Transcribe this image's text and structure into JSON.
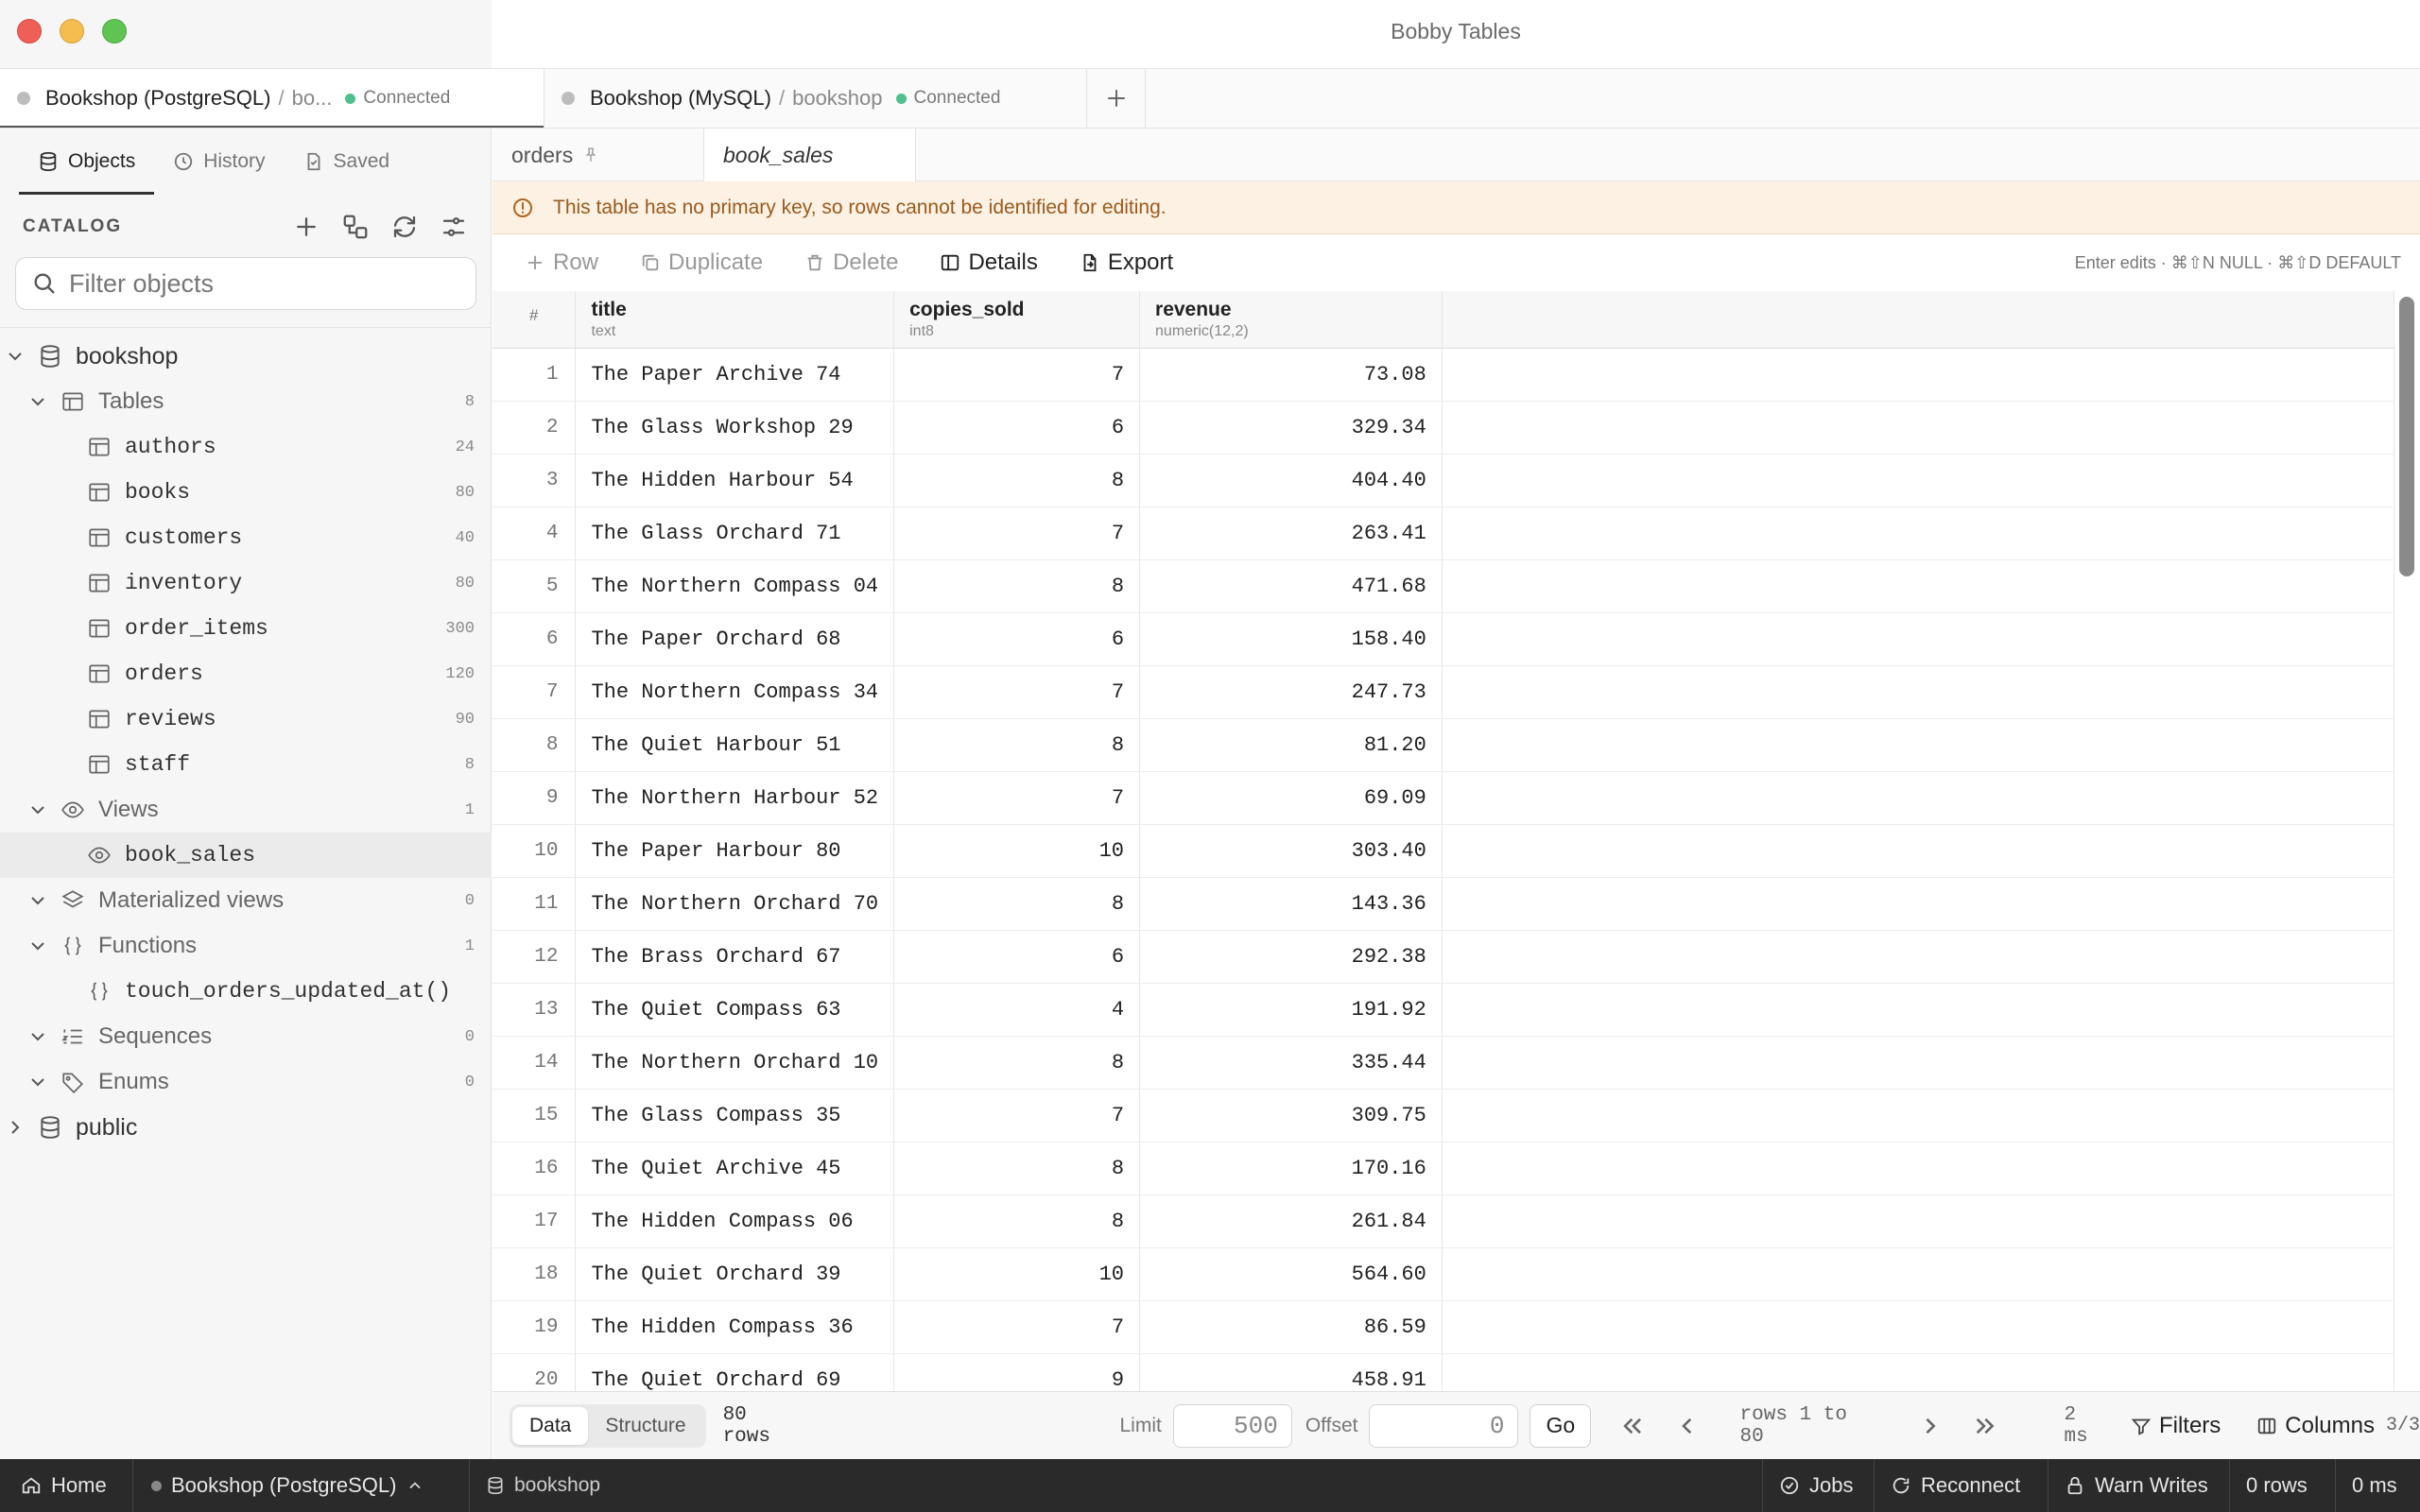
{
  "window": {
    "title": "Bobby Tables"
  },
  "connections": [
    {
      "name": "Bookshop (PostgreSQL)",
      "db": "bo...",
      "status": "Connected"
    },
    {
      "name": "Bookshop (MySQL)",
      "db": "bookshop",
      "status": "Connected"
    }
  ],
  "sidebar": {
    "tabs": [
      "Objects",
      "History",
      "Saved"
    ],
    "catalog_label": "CATALOG",
    "filter_placeholder": "Filter objects",
    "database": "bookshop",
    "tables_label": "Tables",
    "tables_count": "8",
    "tables": [
      {
        "name": "authors",
        "count": "24"
      },
      {
        "name": "books",
        "count": "80"
      },
      {
        "name": "customers",
        "count": "40"
      },
      {
        "name": "inventory",
        "count": "80"
      },
      {
        "name": "order_items",
        "count": "300"
      },
      {
        "name": "orders",
        "count": "120"
      },
      {
        "name": "reviews",
        "count": "90"
      },
      {
        "name": "staff",
        "count": "8"
      }
    ],
    "views_label": "Views",
    "views_count": "1",
    "view_item": "book_sales",
    "matviews_label": "Materialized views",
    "matviews_count": "0",
    "functions_label": "Functions",
    "functions_count": "1",
    "function_item": "touch_orders_updated_at()",
    "sequences_label": "Sequences",
    "sequences_count": "0",
    "enums_label": "Enums",
    "enums_count": "0",
    "schema2": "public"
  },
  "main": {
    "tabs": [
      "orders",
      "book_sales"
    ],
    "warning": "This table has no primary key, so rows cannot be identified for editing.",
    "toolbar": {
      "row": "Row",
      "duplicate": "Duplicate",
      "delete": "Delete",
      "details": "Details",
      "export": "Export",
      "hint": "Enter edits · ⌘⇧N NULL · ⌘⇧D DEFAULT"
    },
    "columns": [
      {
        "name": "#",
        "type": ""
      },
      {
        "name": "title",
        "type": "text"
      },
      {
        "name": "copies_sold",
        "type": "int8"
      },
      {
        "name": "revenue",
        "type": "numeric(12,2)"
      }
    ],
    "rows": [
      [
        "1",
        "The Paper Archive 74",
        "7",
        "73.08"
      ],
      [
        "2",
        "The Glass Workshop 29",
        "6",
        "329.34"
      ],
      [
        "3",
        "The Hidden Harbour 54",
        "8",
        "404.40"
      ],
      [
        "4",
        "The Glass Orchard 71",
        "7",
        "263.41"
      ],
      [
        "5",
        "The Northern Compass 04",
        "8",
        "471.68"
      ],
      [
        "6",
        "The Paper Orchard 68",
        "6",
        "158.40"
      ],
      [
        "7",
        "The Northern Compass 34",
        "7",
        "247.73"
      ],
      [
        "8",
        "The Quiet Harbour 51",
        "8",
        "81.20"
      ],
      [
        "9",
        "The Northern Harbour 52",
        "7",
        "69.09"
      ],
      [
        "10",
        "The Paper Harbour 80",
        "10",
        "303.40"
      ],
      [
        "11",
        "The Northern Orchard 70",
        "8",
        "143.36"
      ],
      [
        "12",
        "The Brass Orchard 67",
        "6",
        "292.38"
      ],
      [
        "13",
        "The Quiet Compass 63",
        "4",
        "191.92"
      ],
      [
        "14",
        "The Northern Orchard 10",
        "8",
        "335.44"
      ],
      [
        "15",
        "The Glass Compass 35",
        "7",
        "309.75"
      ],
      [
        "16",
        "The Quiet Archive 45",
        "8",
        "170.16"
      ],
      [
        "17",
        "The Hidden Compass 06",
        "8",
        "261.84"
      ],
      [
        "18",
        "The Quiet Orchard 39",
        "10",
        "564.60"
      ],
      [
        "19",
        "The Hidden Compass 36",
        "7",
        "86.59"
      ],
      [
        "20",
        "The Quiet Orchard 69",
        "9",
        "458.91"
      ]
    ],
    "bottom": {
      "seg_data": "Data",
      "seg_structure": "Structure",
      "rowcount": "80 rows",
      "limit_label": "Limit",
      "limit_value": "500",
      "offset_label": "Offset",
      "offset_value": "0",
      "go": "Go",
      "range": "rows 1 to 80",
      "time": "2 ms",
      "filters": "Filters",
      "columns_label": "Columns",
      "columns_count": "3/3"
    }
  },
  "statusbar": {
    "home": "Home",
    "connection": "Bookshop (PostgreSQL)",
    "database": "bookshop",
    "jobs": "Jobs",
    "reconnect": "Reconnect",
    "warn_writes": "Warn Writes",
    "rows": "0 rows",
    "time": "0 ms"
  }
}
